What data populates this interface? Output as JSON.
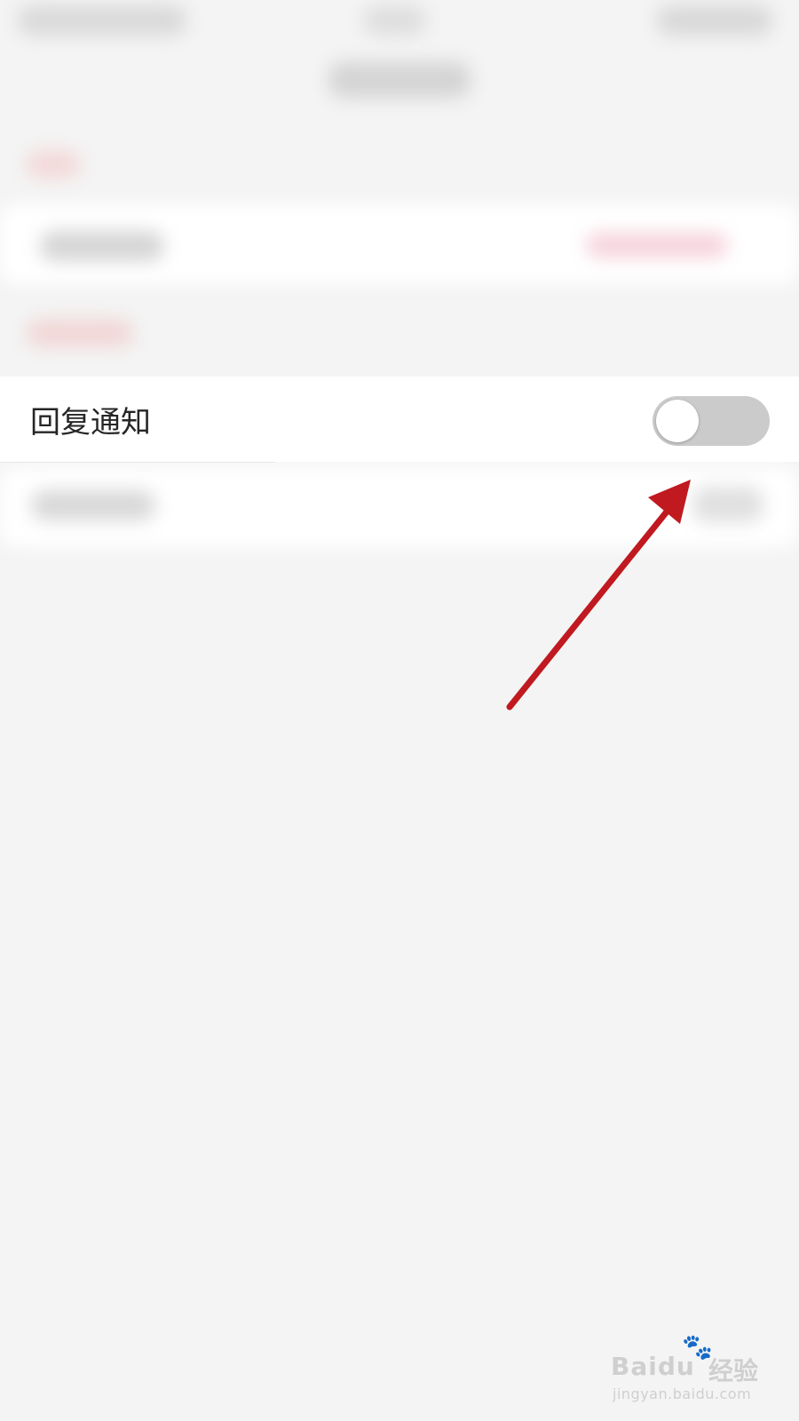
{
  "settings": {
    "reply_notification_label": "回复通知",
    "reply_notification_enabled": false
  },
  "annotation": {
    "arrow_color": "#c0191f"
  },
  "watermark": {
    "brand": "Baidu",
    "title": "经验",
    "url": "jingyan.baidu.com",
    "paw_icon": "paw-icon"
  }
}
